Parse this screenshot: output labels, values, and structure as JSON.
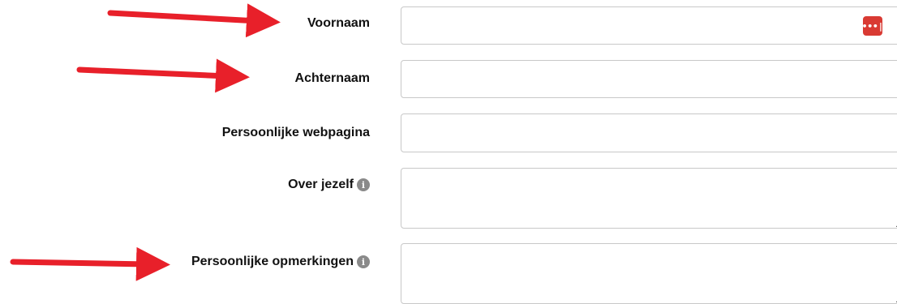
{
  "form": {
    "fields": [
      {
        "label": "Voornaam",
        "value": ""
      },
      {
        "label": "Achternaam",
        "value": ""
      },
      {
        "label": "Persoonlijke webpagina",
        "value": ""
      },
      {
        "label": "Over jezelf",
        "value": "",
        "has_info": true
      },
      {
        "label": "Persoonlijke opmerkingen",
        "value": "",
        "has_info": true
      }
    ]
  },
  "icons": {
    "info": "info-icon",
    "password_manager": "password-manager-icon",
    "arrow": "red-arrow"
  },
  "colors": {
    "arrow": "#e8202a",
    "password_manager": "#d93a33",
    "border": "#c8c8c8",
    "info": "#8a8a8a"
  },
  "glyphs": {
    "info": "i",
    "password_manager": "•••|"
  }
}
